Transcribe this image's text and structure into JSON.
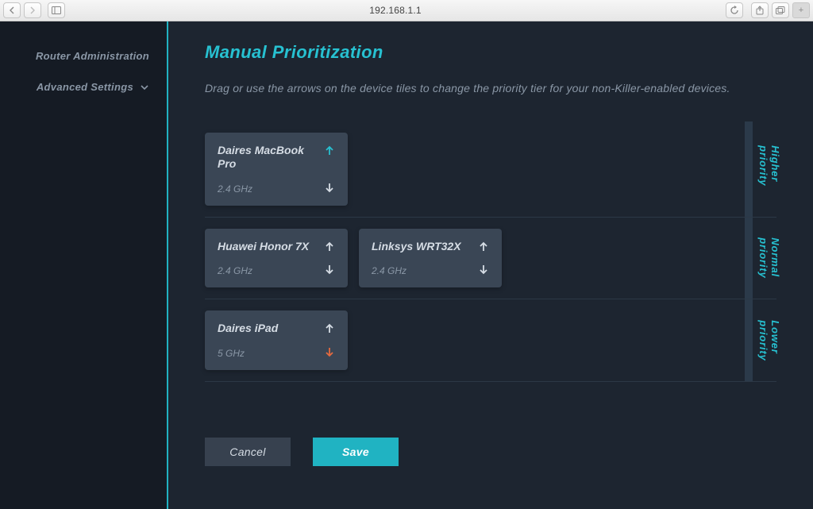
{
  "browser": {
    "address": "192.168.1.1"
  },
  "sidebar": {
    "items": [
      {
        "label": "Router Administration",
        "expandable": false
      },
      {
        "label": "Advanced Settings",
        "expandable": true
      }
    ]
  },
  "page": {
    "title": "Manual Prioritization",
    "hint": "Drag or use the arrows on the device tiles to change the priority tier for your non-Killer-enabled devices."
  },
  "tiers": [
    {
      "label": "Higher priority",
      "devices": [
        {
          "name": "Daires MacBook Pro",
          "band": "2.4 GHz",
          "up_color": "#27c1d1",
          "down_color": "#d6dde5"
        }
      ]
    },
    {
      "label": "Normal priority",
      "devices": [
        {
          "name": "Huawei Honor 7X",
          "band": "2.4 GHz",
          "up_color": "#d6dde5",
          "down_color": "#d6dde5"
        },
        {
          "name": "Linksys WRT32X",
          "band": "2.4 GHz",
          "up_color": "#d6dde5",
          "down_color": "#d6dde5"
        }
      ]
    },
    {
      "label": "Lower priority",
      "devices": [
        {
          "name": "Daires iPad",
          "band": "5 GHz",
          "up_color": "#d6dde5",
          "down_color": "#e56a3f"
        }
      ]
    }
  ],
  "buttons": {
    "cancel": "Cancel",
    "save": "Save"
  }
}
